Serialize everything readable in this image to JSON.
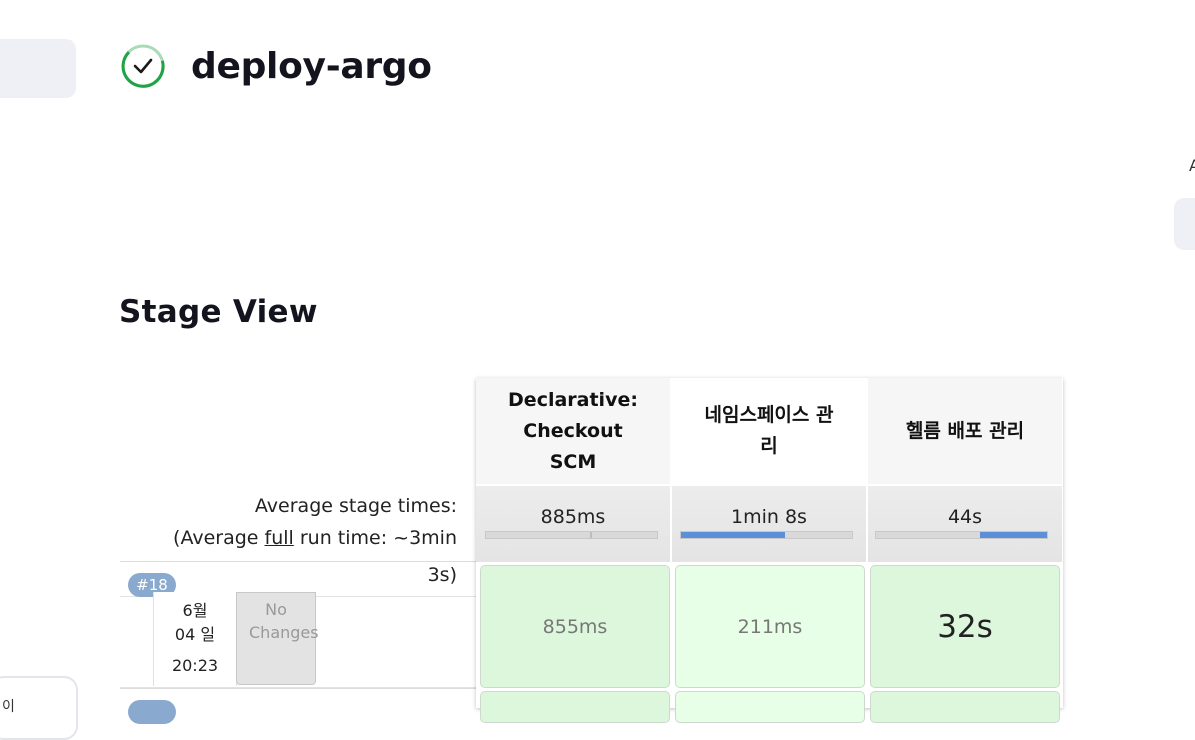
{
  "page": {
    "title": "deploy-argo",
    "status": "success",
    "status_color": "#1ea446",
    "right_edge_text": "A",
    "left_panel_text": "이"
  },
  "stage_view": {
    "title": "Stage View",
    "average_label": "Average stage times:",
    "average_full_prefix": "(Average ",
    "average_full_link": "full",
    "average_full_suffix": " run time: ~3min",
    "average_full_tail": "3s)",
    "stages": [
      {
        "name": "Declarative: Checkout SCM",
        "avg_time": "885ms",
        "avg_fraction": 0.0,
        "split": 0.61
      },
      {
        "name": "네임스페이스 관리",
        "avg_time": "1min 8s",
        "avg_fraction": 0.61
      },
      {
        "name": "헬름 배포 관리",
        "avg_time": "44s",
        "avg_fraction": 0.39,
        "from_right": true
      }
    ],
    "builds": [
      {
        "number": "#18",
        "date": "6월 04 일",
        "time": "20:23",
        "changes": "No Changes",
        "stage_times": [
          "855ms",
          "211ms",
          "32s"
        ]
      }
    ]
  }
}
